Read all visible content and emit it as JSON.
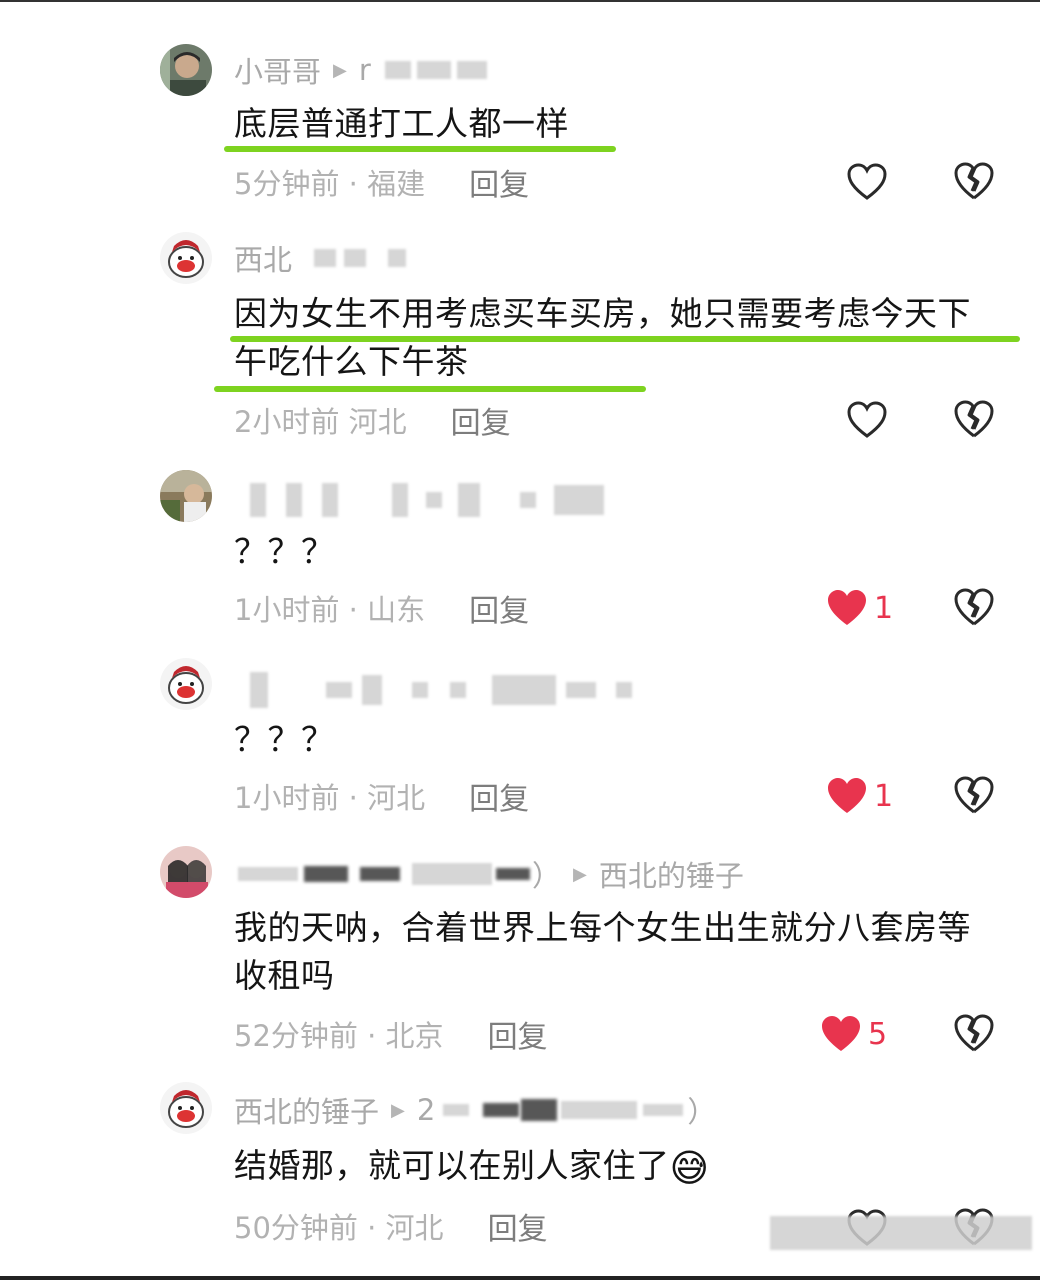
{
  "comments": [
    {
      "username": "小哥哥",
      "reply_prefix": "r",
      "text": "底层普通打工人都一样",
      "time_location": "5分钟前 · 福建",
      "reply_label": "回复",
      "like_count": ""
    },
    {
      "username": "西北",
      "text": "因为女生不用考虑买车买房，她只需要考虑今天下午吃什么下午茶",
      "time_location": "2小时前  河北",
      "reply_label": "回复",
      "like_count": ""
    },
    {
      "username": "",
      "text": "？？？",
      "time_location": "1小时前 · 山东",
      "reply_label": "回复",
      "like_count": "1"
    },
    {
      "username": "",
      "text": "？？？",
      "time_location": "1小时前 · 河北",
      "reply_label": "回复",
      "like_count": "1"
    },
    {
      "username_suffix": "）",
      "reply_to": "西北的锤子",
      "text": "我的天呐，合着世界上每个女生出生就分八套房等收租吗",
      "time_location": "52分钟前 · 北京",
      "reply_label": "回复",
      "like_count": "5"
    },
    {
      "username": "西北的锤子",
      "reply_prefix": "2",
      "username_suffix": "）",
      "text": "结婚那，就可以在别人家住了",
      "emoji": "😅",
      "time_location": "50分钟前 · 河北",
      "reply_label": "回复",
      "like_count": ""
    }
  ],
  "colors": {
    "highlight": "#7ed320",
    "liked_red": "#e8344e",
    "meta_gray": "#b2b2b2"
  },
  "icons": [
    "heart-outline-icon",
    "heart-filled-icon",
    "broken-heart-icon",
    "play-arrow-icon"
  ]
}
